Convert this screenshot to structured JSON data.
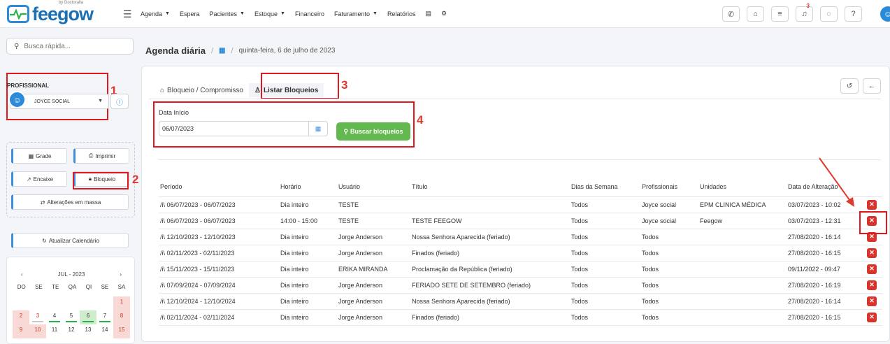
{
  "brand": {
    "name": "feegow",
    "by": "by Doctoralia"
  },
  "nav": [
    {
      "label": "Agenda",
      "dropdown": true
    },
    {
      "label": "Espera",
      "dropdown": false
    },
    {
      "label": "Pacientes",
      "dropdown": true
    },
    {
      "label": "Estoque",
      "dropdown": true
    },
    {
      "label": "Financeiro",
      "dropdown": false
    },
    {
      "label": "Faturamento",
      "dropdown": true
    },
    {
      "label": "Relatórios",
      "dropdown": false
    }
  ],
  "notifications_count": "3",
  "search": {
    "placeholder": "Busca rápida..."
  },
  "sidebar": {
    "professional_label": "PROFISSIONAL",
    "professional_value": "JOYCE SOCIAL",
    "buttons": {
      "grade": "Grade",
      "imprimir": "Imprimir",
      "encaixe": "Encaixe",
      "bloqueio": "Bloqueio",
      "alteracoes": "Alterações em massa"
    },
    "refresh": "Atualizar Calendário"
  },
  "calendar": {
    "month": "JUL - 2023",
    "dow": [
      "DO",
      "SE",
      "TE",
      "QA",
      "QI",
      "SE",
      "SA"
    ],
    "rows": [
      [
        "",
        "",
        "",
        "",
        "",
        "",
        "1"
      ],
      [
        "2",
        "3",
        "4",
        "5",
        "6",
        "7",
        "8"
      ],
      [
        "9",
        "10",
        "11",
        "12",
        "13",
        "14",
        "15"
      ]
    ]
  },
  "page": {
    "title": "Agenda diária",
    "date": "quinta-feira, 6 de julho de 2023"
  },
  "tabs": {
    "tab1": "Bloqueio / Compromisso",
    "tab2": "Listar Bloqueios"
  },
  "filter": {
    "label": "Data Início",
    "value": "06/07/2023",
    "button": "Buscar bloqueios"
  },
  "annotations": [
    "1",
    "2",
    "3",
    "4"
  ],
  "table": {
    "headers": [
      "Período",
      "Horário",
      "Usuário",
      "Título",
      "Dias da Semana",
      "Profissionais",
      "Unidades",
      "Data de Alteração"
    ],
    "rows": [
      [
        "06/07/2023 - 06/07/2023",
        "Dia inteiro",
        "TESTE",
        "",
        "Todos",
        "Joyce social",
        "EPM CLINICA MÉDICA",
        "03/07/2023 - 10:02"
      ],
      [
        "06/07/2023 - 06/07/2023",
        "14:00 - 15:00",
        "TESTE",
        "TESTE FEEGOW",
        "Todos",
        "Joyce social",
        "Feegow",
        "03/07/2023 - 12:31"
      ],
      [
        "12/10/2023 - 12/10/2023",
        "Dia inteiro",
        "Jorge Anderson",
        "Nossa Senhora Aparecida (feriado)",
        "Todos",
        "Todos",
        "",
        "27/08/2020 - 16:14"
      ],
      [
        "02/11/2023 - 02/11/2023",
        "Dia inteiro",
        "Jorge Anderson",
        "Finados (feriado)",
        "Todos",
        "Todos",
        "",
        "27/08/2020 - 16:15"
      ],
      [
        "15/11/2023 - 15/11/2023",
        "Dia inteiro",
        "ERIKA MIRANDA",
        "Proclamação da República (feriado)",
        "Todos",
        "Todos",
        "",
        "09/11/2022 - 09:47"
      ],
      [
        "07/09/2024 - 07/09/2024",
        "Dia inteiro",
        "Jorge Anderson",
        "FERIADO SETE DE SETEMBRO (feriado)",
        "Todos",
        "Todos",
        "",
        "27/08/2020 - 16:19"
      ],
      [
        "12/10/2024 - 12/10/2024",
        "Dia inteiro",
        "Jorge Anderson",
        "Nossa Senhora Aparecida (feriado)",
        "Todos",
        "Todos",
        "",
        "27/08/2020 - 16:14"
      ],
      [
        "02/11/2024 - 02/11/2024",
        "Dia inteiro",
        "Jorge Anderson",
        "Finados (feriado)",
        "Todos",
        "Todos",
        "",
        "27/08/2020 - 16:15"
      ]
    ]
  },
  "colors": {
    "primary": "#2b8bd8",
    "success": "#63b94f",
    "danger": "#d9332b",
    "annotation": "#e0191e"
  }
}
